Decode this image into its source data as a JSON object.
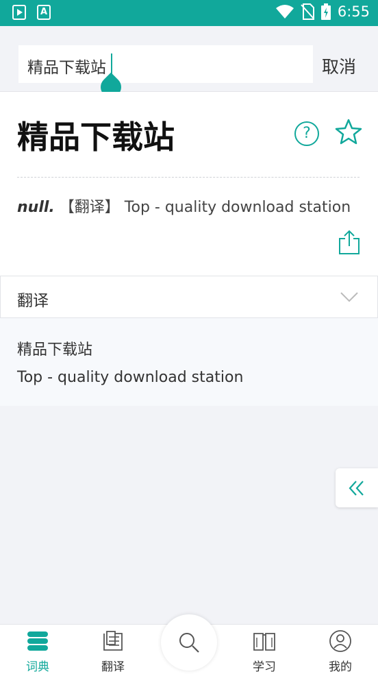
{
  "status_bar": {
    "time": "6:55",
    "icons": [
      "app-icon",
      "font-icon",
      "wifi-icon",
      "no-sim-icon",
      "battery-charging-icon"
    ]
  },
  "search": {
    "query": "精品下载站",
    "cancel_label": "取消"
  },
  "entry": {
    "word": "精品下载站",
    "pos": "null.",
    "tag": "【翻译】",
    "definition": "Top - quality download station"
  },
  "translation": {
    "title": "翻译",
    "source": "精品下载站",
    "result": "Top - quality download station"
  },
  "bottom_nav": {
    "items": [
      {
        "label": "词典",
        "icon": "dictionary-icon",
        "active": true
      },
      {
        "label": "翻译",
        "icon": "translate-icon",
        "active": false
      },
      {
        "label": "学习",
        "icon": "book-icon",
        "active": false
      },
      {
        "label": "我的",
        "icon": "profile-icon",
        "active": false
      }
    ]
  },
  "colors": {
    "accent": "#11a89b",
    "background": "#f2f3f7"
  }
}
